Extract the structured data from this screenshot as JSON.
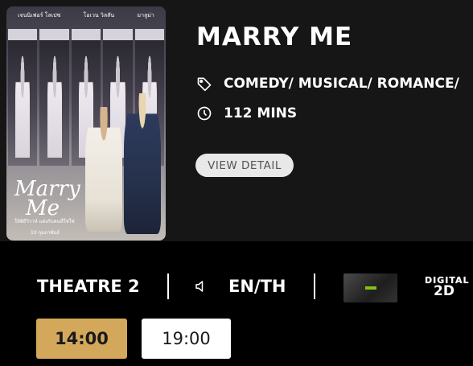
{
  "movie": {
    "title": "MARRY ME",
    "genre": "COMEDY/ MUSICAL/ ROMANCE/",
    "duration": "112 MINS",
    "view_detail_label": "VIEW DETAIL"
  },
  "poster": {
    "credits": [
      "เจนนิเฟอร์ โลเปซ",
      "โอเวน วิลสัน",
      "มาลูม่า"
    ],
    "title_line1": "Marry",
    "title_line2": "Me",
    "tagline": "ให้พิธีวิวาห์ แต่งกับคนที่ใช่ใช่",
    "release": "10 กุมภาพันธ์"
  },
  "showing": {
    "theatre": "THEATRE 2",
    "language": "EN/TH",
    "format_line1": "DIGITAL",
    "format_line2": "2D"
  },
  "showtimes": [
    {
      "time": "14:00",
      "selected": true
    },
    {
      "time": "19:00",
      "selected": false
    }
  ],
  "colors": {
    "selected_time": "#d4a85b",
    "rating_badge": "#7fc31c",
    "card_bg": "#161616"
  }
}
